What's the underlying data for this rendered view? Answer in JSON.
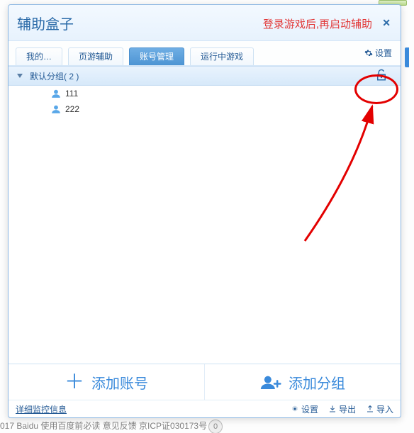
{
  "window": {
    "title": "辅助盒子",
    "warning": "登录游戏后,再启动辅助",
    "close_glyph": "✕"
  },
  "tabs": {
    "items": [
      {
        "label": "我的…"
      },
      {
        "label": "页游辅助"
      },
      {
        "label": "账号管理"
      },
      {
        "label": "运行中游戏"
      }
    ],
    "active_index": 2,
    "settings_label": "设置"
  },
  "groups": {
    "default": {
      "label": "默认分组( 2 )",
      "accounts": [
        {
          "name": "111"
        },
        {
          "name": "222"
        }
      ]
    }
  },
  "footer": {
    "add_account": "添加账号",
    "add_group": "添加分组",
    "detail_link": "详细监控信息",
    "setting": "设置",
    "export": "导出",
    "import": "导入"
  },
  "background": {
    "text": "017 Baidu 使用百度前必读 意见反馈 京ICP证030173号",
    "badge": "0"
  },
  "colors": {
    "accent": "#3a8adb",
    "danger": "#e23838",
    "link": "#245a95"
  }
}
